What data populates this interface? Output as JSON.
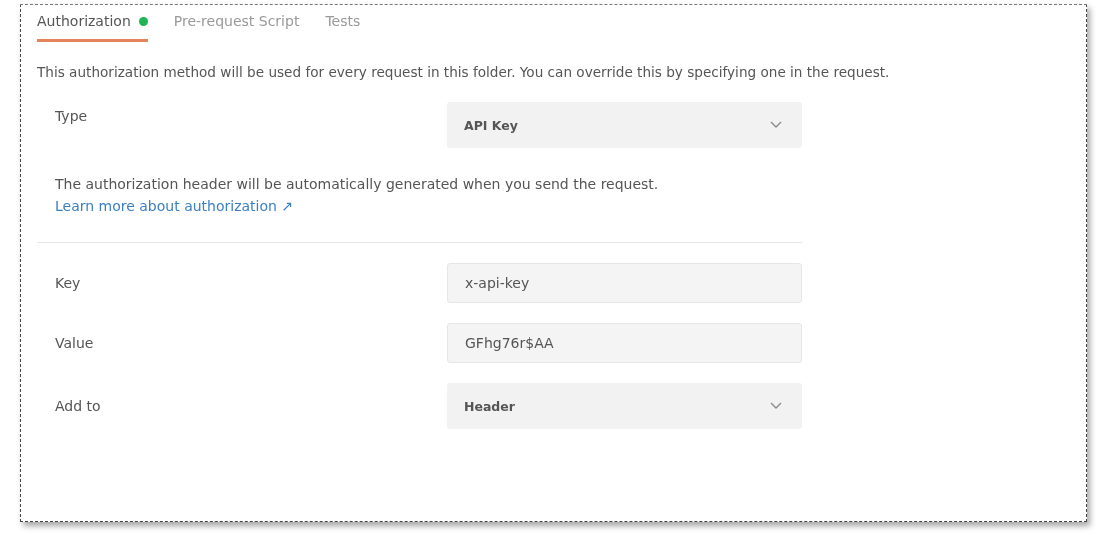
{
  "tabs": [
    {
      "label": "Authorization",
      "selected": true,
      "indicator": true
    },
    {
      "label": "Pre-request Script",
      "selected": false,
      "indicator": false
    },
    {
      "label": "Tests",
      "selected": false,
      "indicator": false
    }
  ],
  "description": "This authorization method will be used for every request in this folder. You can override this by specifying one in the request.",
  "type_row": {
    "label": "Type",
    "kind": "select",
    "value": "API Key"
  },
  "help": {
    "text": "The authorization header will be automatically generated when you send the request.",
    "link": "Learn more about authorization ↗"
  },
  "fields": [
    {
      "label": "Key",
      "kind": "input",
      "value": "x-api-key"
    },
    {
      "label": "Value",
      "kind": "input",
      "value": "GFhg76r$AA"
    },
    {
      "label": "Add to",
      "kind": "select",
      "value": "Header"
    }
  ]
}
